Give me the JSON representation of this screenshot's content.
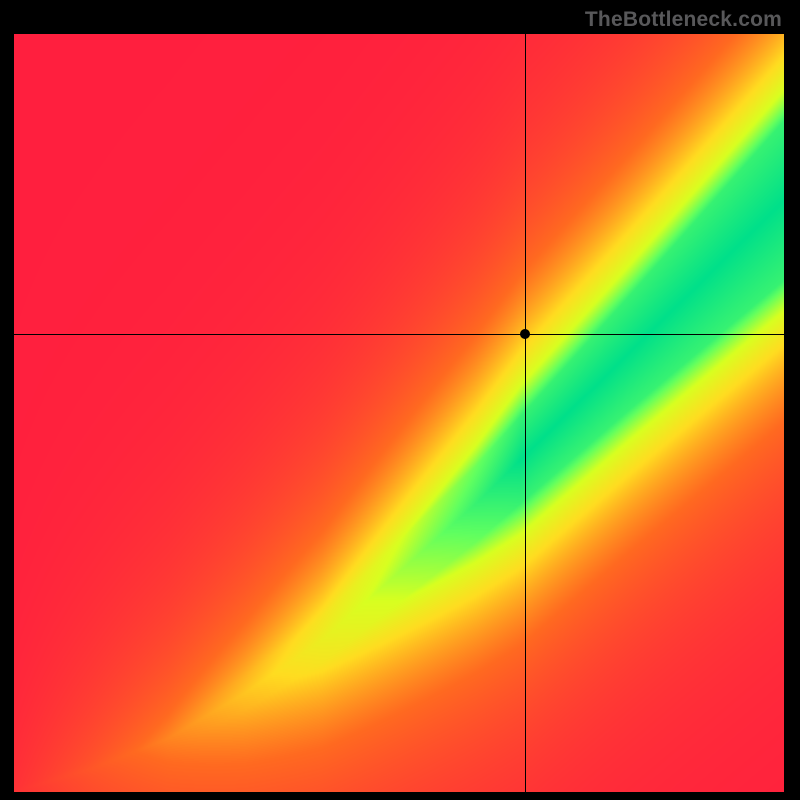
{
  "watermark": "TheBottleneck.com",
  "chart_data": {
    "type": "heatmap",
    "title": "",
    "xlabel": "",
    "ylabel": "",
    "xlim": [
      0,
      1
    ],
    "ylim": [
      0,
      1
    ],
    "crosshair": {
      "x": 0.664,
      "y": 0.604
    },
    "marker": {
      "x": 0.664,
      "y": 0.604
    },
    "color_stops": [
      {
        "t": 0.0,
        "color": "#ff1f3e"
      },
      {
        "t": 0.3,
        "color": "#ff6a20"
      },
      {
        "t": 0.55,
        "color": "#ffdc20"
      },
      {
        "t": 0.72,
        "color": "#d8ff20"
      },
      {
        "t": 0.86,
        "color": "#60ff60"
      },
      {
        "t": 1.0,
        "color": "#00e08a"
      }
    ],
    "ridge": [
      {
        "x": 0.0,
        "y": 0.0
      },
      {
        "x": 0.1,
        "y": 0.03
      },
      {
        "x": 0.2,
        "y": 0.07
      },
      {
        "x": 0.3,
        "y": 0.13
      },
      {
        "x": 0.4,
        "y": 0.2
      },
      {
        "x": 0.5,
        "y": 0.29
      },
      {
        "x": 0.6,
        "y": 0.38
      },
      {
        "x": 0.7,
        "y": 0.48
      },
      {
        "x": 0.8,
        "y": 0.58
      },
      {
        "x": 0.9,
        "y": 0.68
      },
      {
        "x": 1.0,
        "y": 0.78
      }
    ],
    "ridge_halfwidth": [
      {
        "x": 0.0,
        "w": 0.005
      },
      {
        "x": 0.2,
        "w": 0.015
      },
      {
        "x": 0.4,
        "w": 0.03
      },
      {
        "x": 0.6,
        "w": 0.05
      },
      {
        "x": 0.8,
        "w": 0.075
      },
      {
        "x": 1.0,
        "w": 0.105
      }
    ],
    "description": "Smooth 2D heatmap. A narrow green optimal band runs diagonally from the lower-left corner up toward the right edge, widening as x increases. Values fall off through yellow to orange to red away from the band. A black crosshair and dot mark a point above the green band (yellow region)."
  }
}
